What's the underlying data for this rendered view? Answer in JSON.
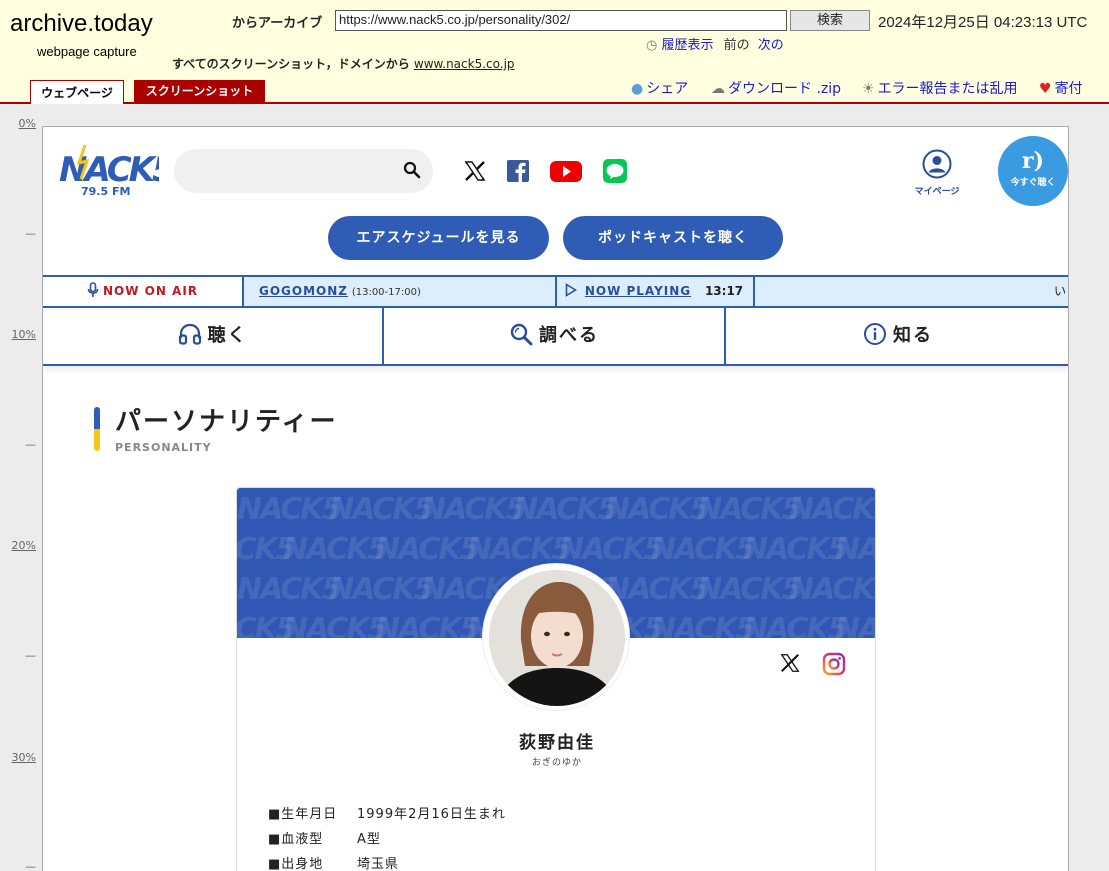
{
  "archive": {
    "logo": "archive.today",
    "subtitle": "webpage capture",
    "from_archive": "からアーカイブ",
    "url": "https://www.nack5.co.jp/personality/302/",
    "search_label": "検索",
    "date": "2024年12月25日 04:23:13 UTC",
    "history": "履歴表示",
    "prev": "前の",
    "next": "次の",
    "all_screenshots": "すべてのスクリーンショット，ドメインから",
    "domain": "www.nack5.co.jp",
    "tabs": {
      "webpage": "ウェブページ",
      "screenshot": "スクリーンショット"
    },
    "tools": {
      "share": "シェア",
      "download": "ダウンロード .zip",
      "report": "エラー報告または乱用",
      "donate": "寄付"
    }
  },
  "ruler": [
    "0%",
    "—",
    "10%",
    "—",
    "20%",
    "—",
    "30%",
    "—"
  ],
  "site": {
    "logo_text": "NACK5",
    "logo_freq": "79.5 FM",
    "mypage": "マイページ",
    "listen_now": "今すぐ聴く",
    "schedule_button": "エアスケジュールを見る",
    "podcast_button": "ポッドキャストを聴く",
    "onair": {
      "label": "NOW ON AIR",
      "program": "GOGOMONZ",
      "program_time": "(13:00-17:00)",
      "now_playing": "NOW PLAYING",
      "clock": "13:17",
      "ticker": "い"
    },
    "nav": {
      "listen": "聴く",
      "search": "調べる",
      "know": "知る"
    }
  },
  "page": {
    "title": "パーソナリティー",
    "subtitle": "PERSONALITY"
  },
  "profile": {
    "name": "荻野由佳",
    "kana": "おぎのゆか",
    "rows": [
      {
        "key": "■生年月日",
        "value": "1999年2月16日生まれ"
      },
      {
        "key": "■血液型",
        "value": "A型"
      },
      {
        "key": "■出身地",
        "value": "埼玉県"
      }
    ]
  },
  "colors": {
    "brand_blue": "#2f5cb5",
    "archive_red": "#aa0000",
    "onair_red": "#c2181f",
    "archive_bg": "#ffffe0"
  }
}
